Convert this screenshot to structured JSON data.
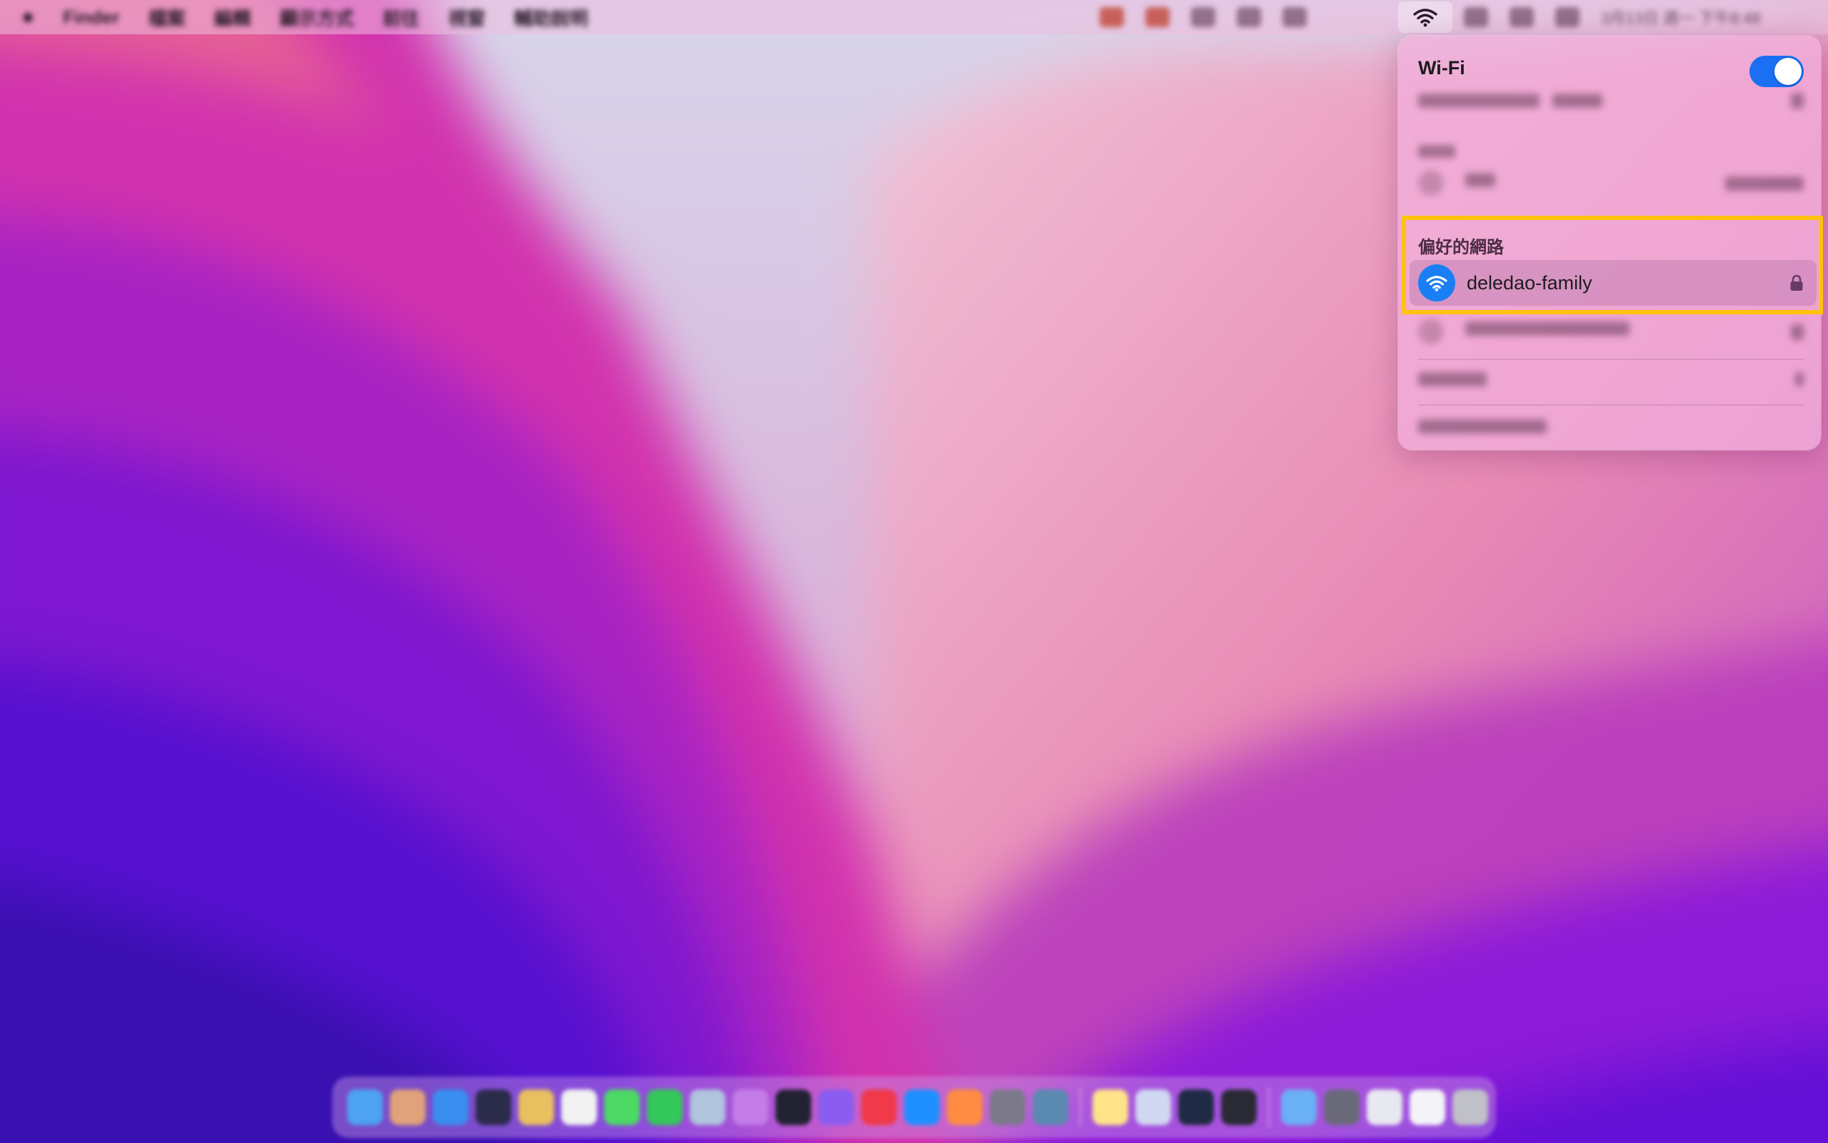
{
  "menubar": {
    "app_name": "Finder",
    "menu_items": [
      "檔案",
      "編輯",
      "顯示方式",
      "前往",
      "視窗",
      "輔助說明"
    ],
    "clock_text": "3月13日 週一 下午8:48"
  },
  "wifi_panel": {
    "title": "Wi-Fi",
    "toggle_on": true,
    "preferred_section_label": "偏好的網路",
    "network": {
      "name": "deledao-family",
      "secured": true,
      "connected": true
    }
  },
  "colors": {
    "accent_blue": "#1a7ef5",
    "toggle_blue": "#1a6ff2",
    "highlight_yellow": "#ffc20e"
  },
  "icons": {
    "menubar_apple": "apple-logo-icon",
    "menubar_wifi": "wifi-icon",
    "network_wifi": "wifi-icon",
    "network_lock": "lock-icon"
  }
}
